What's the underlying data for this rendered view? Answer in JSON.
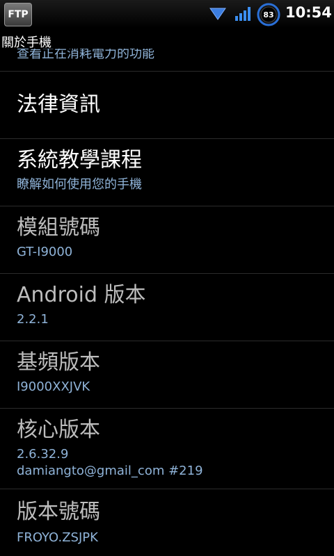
{
  "status_bar": {
    "ftp_label": "FTP",
    "battery_level": "83",
    "time": "10:54"
  },
  "header": {
    "title": "關於手機",
    "partial_summary": "查看正在消耗電力的功能"
  },
  "items": [
    {
      "title": "法律資訊",
      "subtitle": ""
    },
    {
      "title": "系統教學課程",
      "subtitle": "瞭解如何使用您的手機"
    },
    {
      "title": "模組號碼",
      "subtitle": "GT-I9000"
    },
    {
      "title": "Android 版本",
      "subtitle": "2.2.1"
    },
    {
      "title": "基頻版本",
      "subtitle": "I9000XXJVK"
    },
    {
      "title": "核心版本",
      "subtitle": "2.6.32.9",
      "subtitle2": "damiangto@gmail_com #219"
    },
    {
      "title": "版本號碼",
      "subtitle": "FROYO.ZSJPK"
    }
  ]
}
